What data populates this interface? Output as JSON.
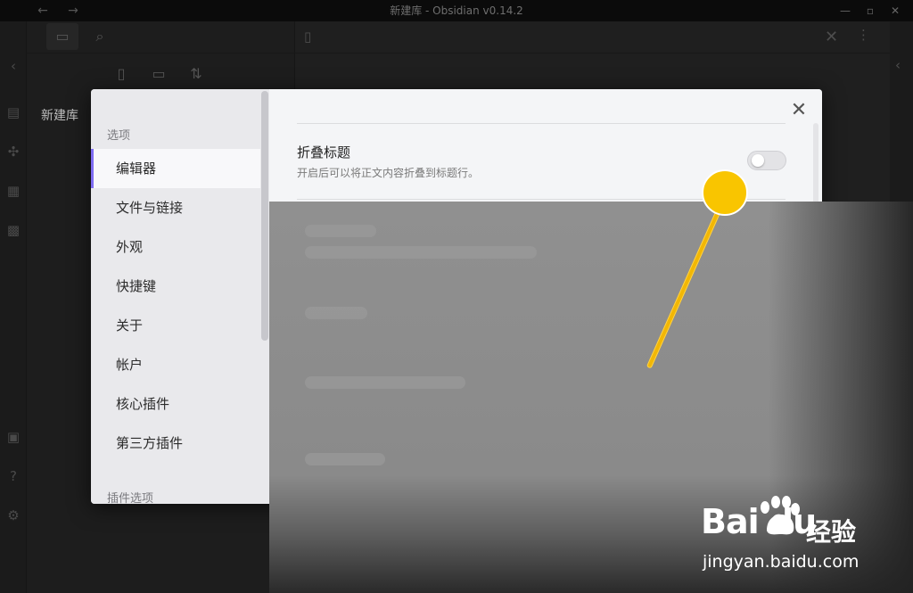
{
  "window": {
    "title": "新建库 - Obsidian v0.14.2",
    "back_icon": "arrow-left-icon",
    "forward_icon": "arrow-right-icon"
  },
  "file_pane": {
    "vault_name": "新建库"
  },
  "settings": {
    "sidebar": {
      "options_header": "选项",
      "items": [
        {
          "label": "编辑器",
          "active": true
        },
        {
          "label": "文件与链接",
          "active": false
        },
        {
          "label": "外观",
          "active": false
        },
        {
          "label": "快捷键",
          "active": false
        },
        {
          "label": "关于",
          "active": false
        },
        {
          "label": "帐户",
          "active": false
        },
        {
          "label": "核心插件",
          "active": false
        },
        {
          "label": "第三方插件",
          "active": false
        }
      ],
      "plugin_options_header": "插件选项"
    },
    "content": {
      "setting_name": "折叠标题",
      "setting_desc": "开启后可以将正文内容折叠到标题行。",
      "toggle_on": false
    }
  },
  "colors": {
    "accent": "#7f6df2",
    "annotation": "#f9c500"
  },
  "watermark": {
    "brand": "Bai du",
    "cn": "经验",
    "url": "jingyan.baidu.com"
  }
}
